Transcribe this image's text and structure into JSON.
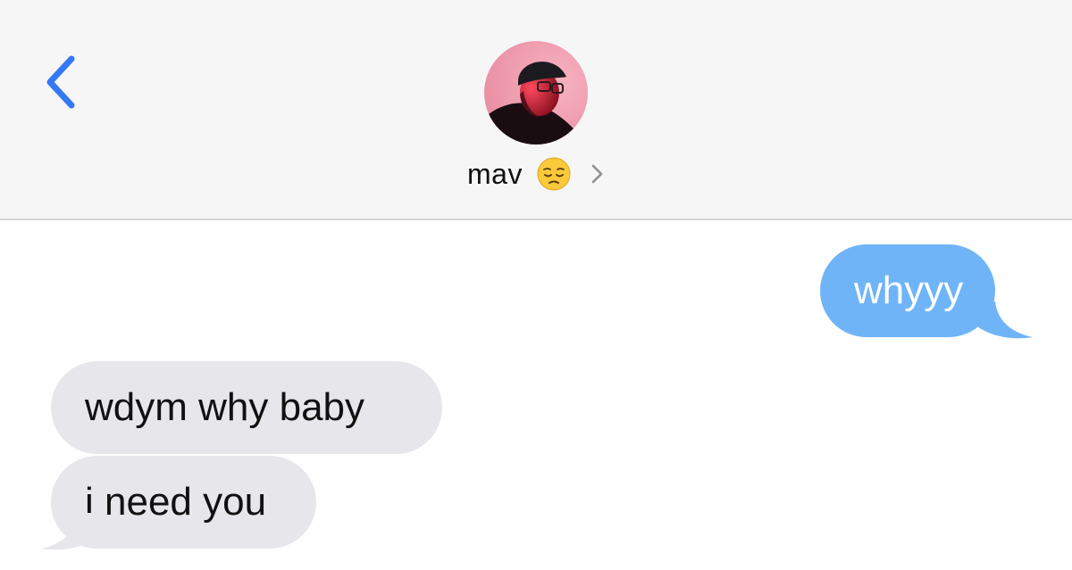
{
  "header": {
    "back_icon": "chevron-left-icon",
    "contact_name": "mav",
    "contact_emoji": "pensive-face-emoji",
    "details_icon": "chevron-right-icon"
  },
  "messages": [
    {
      "direction": "outgoing",
      "text": "whyyy"
    },
    {
      "direction": "incoming",
      "text": "wdym why baby"
    },
    {
      "direction": "incoming",
      "text": "i need you"
    }
  ],
  "colors": {
    "outgoing_bubble": "#6fb4f7",
    "incoming_bubble": "#e6e6eb",
    "accent": "#3478f6",
    "header_bg": "#f6f6f7"
  }
}
